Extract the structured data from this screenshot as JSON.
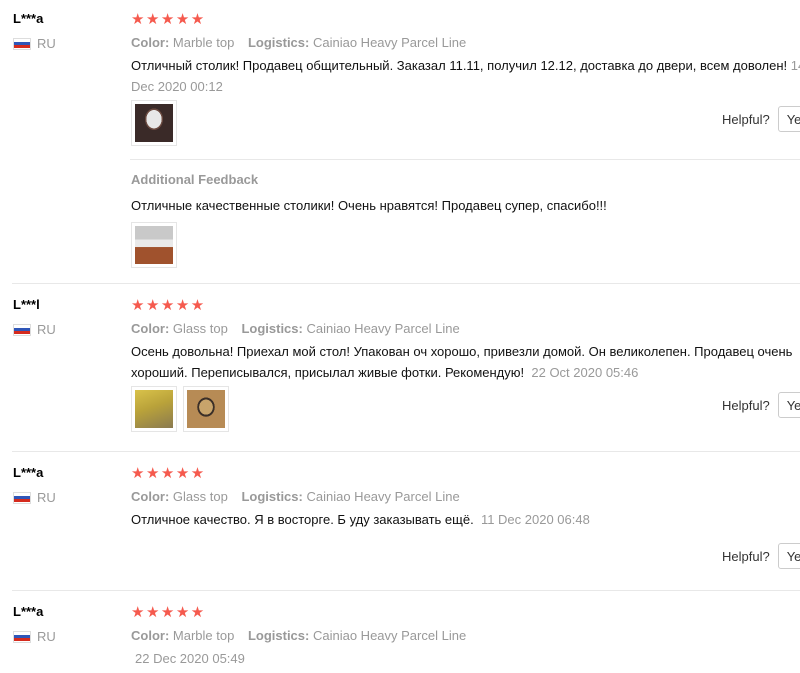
{
  "labels": {
    "color": "Color:",
    "logistics": "Logistics:",
    "helpful": "Helpful?",
    "yes": "Yes",
    "additional_feedback": "Additional Feedback"
  },
  "reviews": [
    {
      "user": "L***a",
      "country": "RU",
      "rating": 5,
      "stars": "★★★★★",
      "color": "Marble top",
      "logistics": "Cainiao Heavy Parcel Line",
      "text_line1": "Отличный столик! Продавец общительный. Заказал 11.11, получил 12.12, доставка до двери, всем доволен!",
      "date_part1": "14",
      "date_part2": "Dec 2020 00:12",
      "photos": [
        "marble-table-photo"
      ],
      "additional": {
        "text": "Отличные качественные столики! Очень нравятся! Продавец супер, спасибо!!!",
        "photos": [
          "room-table-photo"
        ]
      }
    },
    {
      "user": "L***l",
      "country": "RU",
      "rating": 5,
      "stars": "★★★★★",
      "color": "Glass top",
      "logistics": "Cainiao Heavy Parcel Line",
      "text_line1": "Осень довольна! Приехал мой стол! Упакован оч хорошо, привезли домой. Он великолепен. Продавец очень",
      "text_line2": "хороший. Переписывался, присылал живые фотки. Рекомендую!",
      "date": "22 Oct 2020 05:46",
      "photos": [
        "glass-table-photo",
        "frame-table-photo"
      ]
    },
    {
      "user": "L***a",
      "country": "RU",
      "rating": 5,
      "stars": "★★★★★",
      "color": "Glass top",
      "logistics": "Cainiao Heavy Parcel Line",
      "text_line1": "Отличное качество. Я в восторге. Б уду заказывать ещё.",
      "date": "11 Dec 2020 06:48"
    },
    {
      "user": "L***a",
      "country": "RU",
      "rating": 5,
      "stars": "★★★★★",
      "color": "Marble top",
      "logistics": "Cainiao Heavy Parcel Line",
      "date": "22 Dec 2020 05:49"
    }
  ]
}
